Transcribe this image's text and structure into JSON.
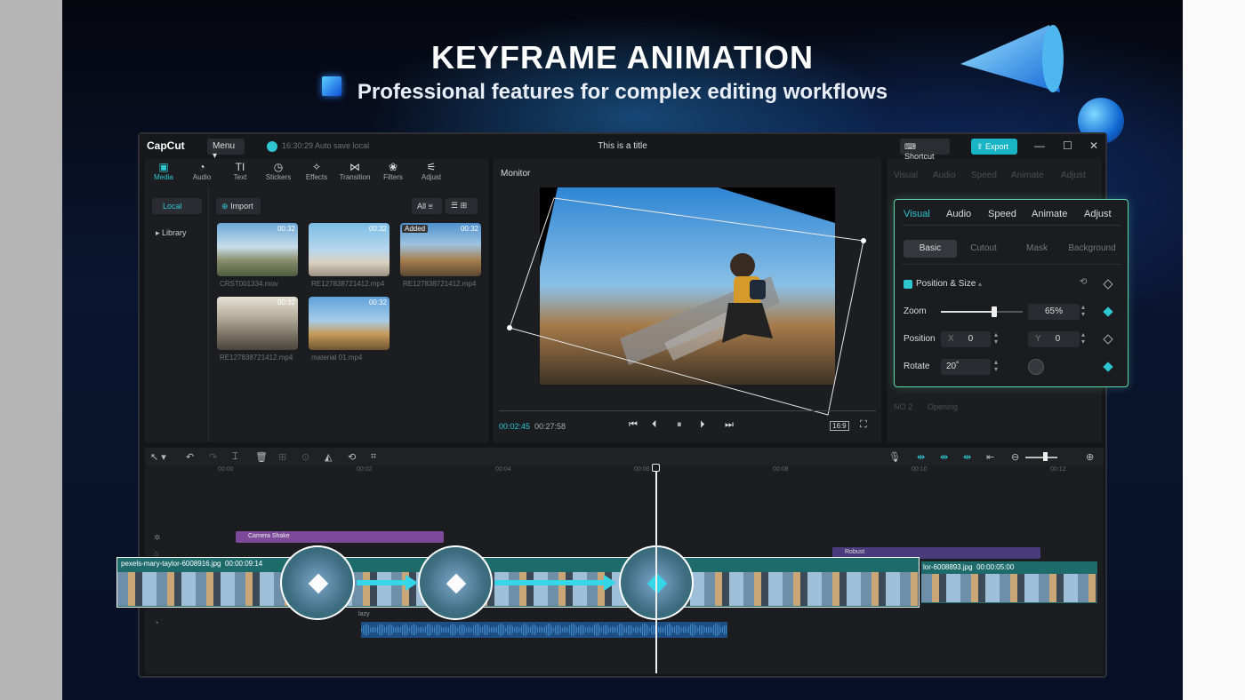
{
  "hero": {
    "title": "KEYFRAME ANIMATION",
    "subtitle": "Professional features for complex editing workflows"
  },
  "app": {
    "logo": "CapCut",
    "menu": "Menu",
    "autosave": "16:30:29 Auto save local",
    "title": "This is a title",
    "shortcut": "Shortcut",
    "export": "Export",
    "window_buttons": [
      "—",
      "☐",
      "✕"
    ]
  },
  "toolbar": [
    {
      "label": "Media",
      "icon": "▣",
      "active": true
    },
    {
      "label": "Audio",
      "icon": "◔"
    },
    {
      "label": "Text",
      "icon": "TI"
    },
    {
      "label": "Stickers",
      "icon": "◷"
    },
    {
      "label": "Effects",
      "icon": "✧"
    },
    {
      "label": "Transition",
      "icon": "⋈"
    },
    {
      "label": "Filters",
      "icon": "❀"
    },
    {
      "label": "Adjust",
      "icon": "⚟"
    }
  ],
  "media": {
    "side": [
      "Local",
      "▸ Library"
    ],
    "import": "Import",
    "filter": "All",
    "items": [
      {
        "name": "CRST001334.mov",
        "duration": "00:32",
        "badge": ""
      },
      {
        "name": "RE127838721412.mp4",
        "duration": "00:32",
        "badge": ""
      },
      {
        "name": "RE127838721412.mp4",
        "duration": "00:32",
        "badge": "Added"
      },
      {
        "name": "RE127838721412.mp4",
        "duration": "00:32",
        "badge": ""
      },
      {
        "name": "material 01.mp4",
        "duration": "00:32",
        "badge": ""
      }
    ]
  },
  "monitor": {
    "title": "Monitor",
    "current": "00:02:45",
    "total": "00:27:58",
    "ratio": "16:9"
  },
  "right_panel_bg": {
    "tabs": [
      "Visual",
      "Audio",
      "Speed",
      "Animate",
      "Adjust"
    ],
    "footer": [
      "NO 2",
      "Opening"
    ]
  },
  "props": {
    "tabs": [
      "Visual",
      "Audio",
      "Speed",
      "Animate",
      "Adjust"
    ],
    "subtabs": [
      "Basic",
      "Cutout",
      "Mask",
      "Background"
    ],
    "section": "Position & Size",
    "zoom_label": "Zoom",
    "zoom_value": "65%",
    "zoom_level": 0.65,
    "position_label": "Position",
    "x_label": "X",
    "x_value": "0",
    "y_label": "Y",
    "y_value": "0",
    "rotate_label": "Rotate",
    "rotate_value": "20˚"
  },
  "timeline": {
    "ticks": [
      "00:00",
      "00:02",
      "00:04",
      "00:06",
      "00:08",
      "00:10",
      "00:12"
    ],
    "effect_clip": "Camera Shake",
    "effect_clip2": "Robust",
    "main_clip": {
      "name": "pexels-mary-taylor-6008916.jpg",
      "duration": "00:00:09:14"
    },
    "second_clip": {
      "name": "lor-6008893.jpg",
      "duration": "00:00:05:00"
    },
    "audio_label": "lazy"
  },
  "colors": {
    "accent": "#2ec7d1",
    "panel_border": "#5fd7a6",
    "effect": "#7c4a98"
  }
}
